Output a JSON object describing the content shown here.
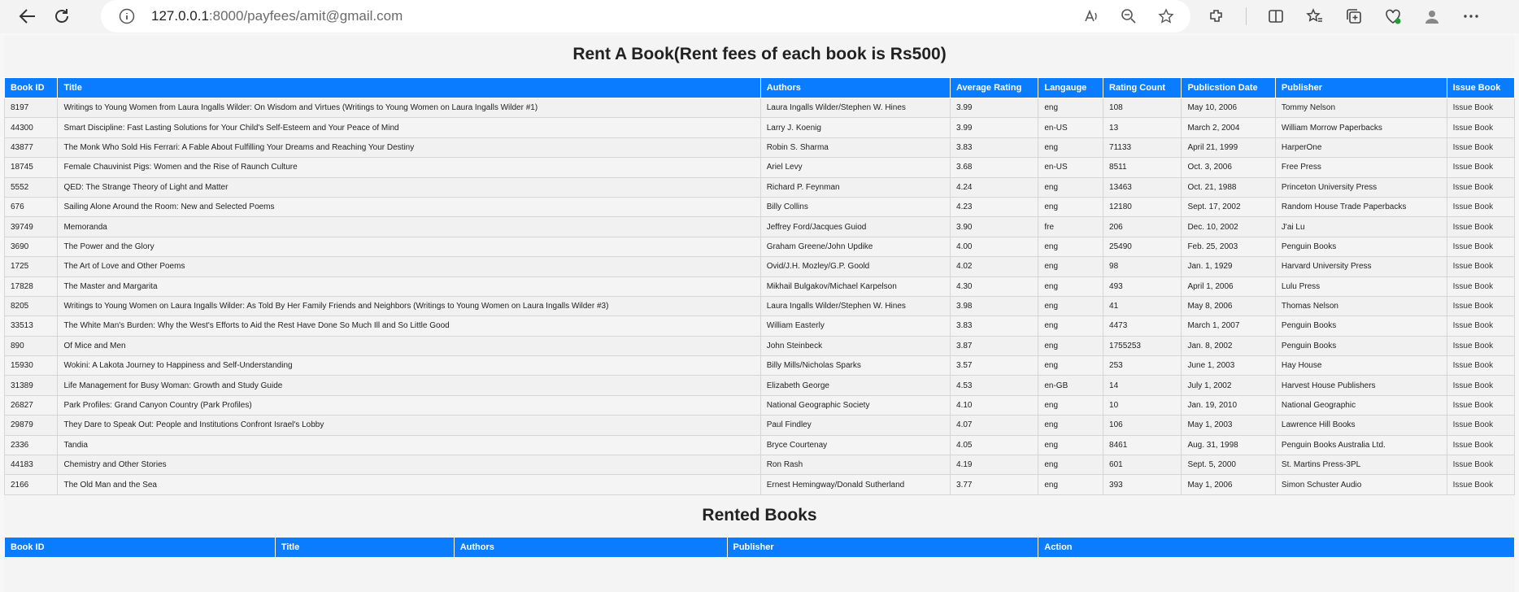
{
  "browser": {
    "url_host": "127.0.0.1",
    "url_rest": ":8000/payfees/amit@gmail.com"
  },
  "page": {
    "title": "Rent A Book(Rent fees of each book is Rs500)",
    "rented_title": "Rented Books"
  },
  "books_table": {
    "headers": [
      "Book ID",
      "Title",
      "Authors",
      "Average Rating",
      "Langauge",
      "Rating Count",
      "Publicstion Date",
      "Publisher",
      "Issue Book"
    ],
    "rows": [
      [
        "8197",
        "Writings to Young Women from Laura Ingalls Wilder: On Wisdom and Virtues (Writings to Young Women on Laura Ingalls Wilder #1)",
        "Laura Ingalls Wilder/Stephen W. Hines",
        "3.99",
        "eng",
        "108",
        "May 10, 2006",
        "Tommy Nelson",
        "Issue Book"
      ],
      [
        "44300",
        "Smart Discipline: Fast Lasting Solutions for Your Child's Self-Esteem and Your Peace of Mind",
        "Larry J. Koenig",
        "3.99",
        "en-US",
        "13",
        "March 2, 2004",
        "William Morrow Paperbacks",
        "Issue Book"
      ],
      [
        "43877",
        "The Monk Who Sold His Ferrari: A Fable About Fulfilling Your Dreams and Reaching Your Destiny",
        "Robin S. Sharma",
        "3.83",
        "eng",
        "71133",
        "April 21, 1999",
        "HarperOne",
        "Issue Book"
      ],
      [
        "18745",
        "Female Chauvinist Pigs: Women and the Rise of Raunch Culture",
        "Ariel Levy",
        "3.68",
        "en-US",
        "8511",
        "Oct. 3, 2006",
        "Free Press",
        "Issue Book"
      ],
      [
        "5552",
        "QED: The Strange Theory of Light and Matter",
        "Richard P. Feynman",
        "4.24",
        "eng",
        "13463",
        "Oct. 21, 1988",
        "Princeton University Press",
        "Issue Book"
      ],
      [
        "676",
        "Sailing Alone Around the Room: New and Selected Poems",
        "Billy Collins",
        "4.23",
        "eng",
        "12180",
        "Sept. 17, 2002",
        "Random House Trade Paperbacks",
        "Issue Book"
      ],
      [
        "39749",
        "Memoranda",
        "Jeffrey Ford/Jacques Guiod",
        "3.90",
        "fre",
        "206",
        "Dec. 10, 2002",
        "J'ai Lu",
        "Issue Book"
      ],
      [
        "3690",
        "The Power and the Glory",
        "Graham Greene/John Updike",
        "4.00",
        "eng",
        "25490",
        "Feb. 25, 2003",
        "Penguin Books",
        "Issue Book"
      ],
      [
        "1725",
        "The Art of Love and Other Poems",
        "Ovid/J.H. Mozley/G.P. Goold",
        "4.02",
        "eng",
        "98",
        "Jan. 1, 1929",
        "Harvard University Press",
        "Issue Book"
      ],
      [
        "17828",
        "The Master and Margarita",
        "Mikhail Bulgakov/Michael Karpelson",
        "4.30",
        "eng",
        "493",
        "April 1, 2006",
        "Lulu Press",
        "Issue Book"
      ],
      [
        "8205",
        "Writings to Young Women on Laura Ingalls Wilder: As Told By Her Family Friends and Neighbors (Writings to Young Women on Laura Ingalls Wilder #3)",
        "Laura Ingalls Wilder/Stephen W. Hines",
        "3.98",
        "eng",
        "41",
        "May 8, 2006",
        "Thomas Nelson",
        "Issue Book"
      ],
      [
        "33513",
        "The White Man's Burden: Why the West's Efforts to Aid the Rest Have Done So Much Ill and So Little Good",
        "William Easterly",
        "3.83",
        "eng",
        "4473",
        "March 1, 2007",
        "Penguin Books",
        "Issue Book"
      ],
      [
        "890",
        "Of Mice and Men",
        "John Steinbeck",
        "3.87",
        "eng",
        "1755253",
        "Jan. 8, 2002",
        "Penguin Books",
        "Issue Book"
      ],
      [
        "15930",
        "Wokini: A Lakota Journey to Happiness and Self-Understanding",
        "Billy Mills/Nicholas Sparks",
        "3.57",
        "eng",
        "253",
        "June 1, 2003",
        "Hay House",
        "Issue Book"
      ],
      [
        "31389",
        "Life Management for Busy Woman: Growth and Study Guide",
        "Elizabeth George",
        "4.53",
        "en-GB",
        "14",
        "July 1, 2002",
        "Harvest House Publishers",
        "Issue Book"
      ],
      [
        "26827",
        "Park Profiles: Grand Canyon Country (Park Profiles)",
        "National Geographic Society",
        "4.10",
        "eng",
        "10",
        "Jan. 19, 2010",
        "National Geographic",
        "Issue Book"
      ],
      [
        "29879",
        "They Dare to Speak Out: People and Institutions Confront Israel's Lobby",
        "Paul Findley",
        "4.07",
        "eng",
        "106",
        "May 1, 2003",
        "Lawrence Hill Books",
        "Issue Book"
      ],
      [
        "2336",
        "Tandia",
        "Bryce Courtenay",
        "4.05",
        "eng",
        "8461",
        "Aug. 31, 1998",
        "Penguin Books Australia Ltd.",
        "Issue Book"
      ],
      [
        "44183",
        "Chemistry and Other Stories",
        "Ron Rash",
        "4.19",
        "eng",
        "601",
        "Sept. 5, 2000",
        "St. Martins Press-3PL",
        "Issue Book"
      ],
      [
        "2166",
        "The Old Man and the Sea",
        "Ernest Hemingway/Donald Sutherland",
        "3.77",
        "eng",
        "393",
        "May 1, 2006",
        "Simon Schuster Audio",
        "Issue Book"
      ]
    ]
  },
  "rented_table": {
    "headers": [
      "Book ID",
      "Title",
      "Authors",
      "Publisher",
      "Action"
    ]
  },
  "colors": {
    "header_bg": "#0a7cff"
  }
}
